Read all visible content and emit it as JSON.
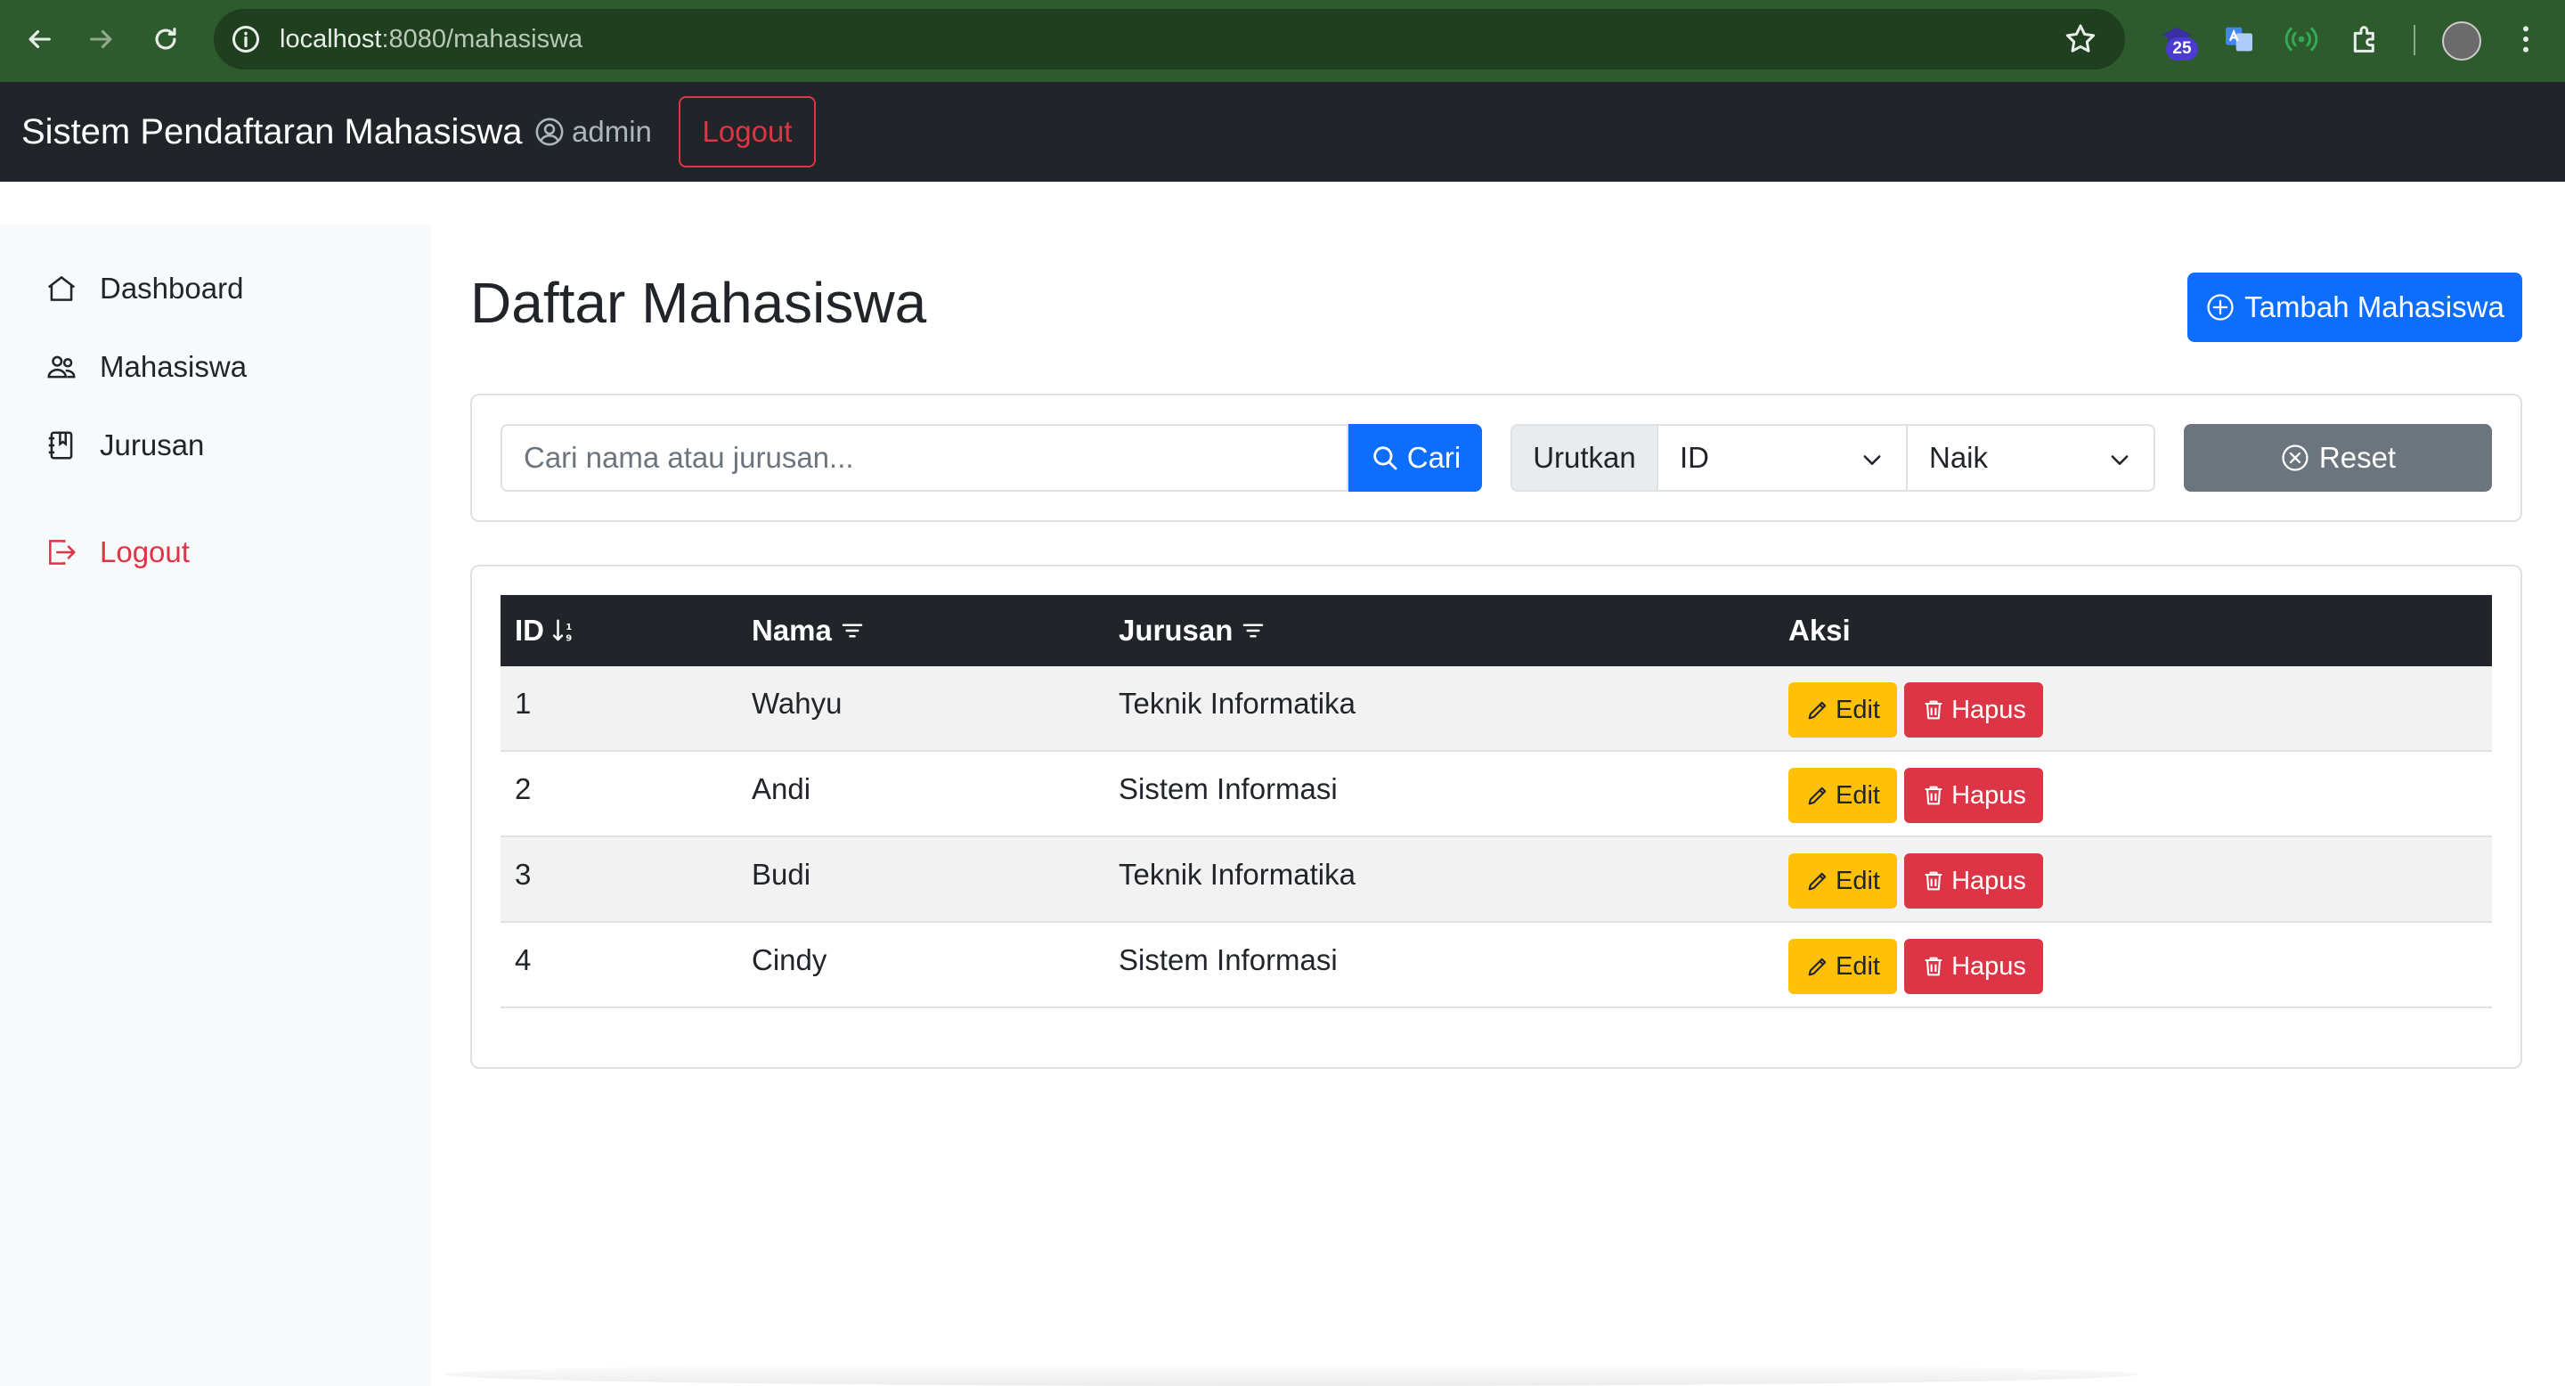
{
  "browser": {
    "url_host": "localhost",
    "url_rest": ":8080/mahasiswa",
    "extension_badge": "25"
  },
  "navbar": {
    "brand": "Sistem Pendaftaran Mahasiswa",
    "user": "admin",
    "logout_label": "Logout"
  },
  "sidebar": {
    "items": [
      {
        "label": "Dashboard",
        "icon": "house-icon"
      },
      {
        "label": "Mahasiswa",
        "icon": "people-icon"
      },
      {
        "label": "Jurusan",
        "icon": "journal-icon"
      }
    ],
    "logout_label": "Logout"
  },
  "page": {
    "title": "Daftar Mahasiswa",
    "add_button": "Tambah Mahasiswa"
  },
  "search": {
    "placeholder": "Cari nama atau jurusan...",
    "button": "Cari",
    "sort_label": "Urutkan",
    "sort_field": "ID",
    "sort_order": "Naik",
    "reset_button": "Reset"
  },
  "table": {
    "headers": [
      "ID",
      "Nama",
      "Jurusan",
      "Aksi"
    ],
    "rows": [
      {
        "id": "1",
        "nama": "Wahyu",
        "jurusan": "Teknik Informatika"
      },
      {
        "id": "2",
        "nama": "Andi",
        "jurusan": "Sistem Informasi"
      },
      {
        "id": "3",
        "nama": "Budi",
        "jurusan": "Teknik Informatika"
      },
      {
        "id": "4",
        "nama": "Cindy",
        "jurusan": "Sistem Informasi"
      }
    ],
    "edit_label": "Edit",
    "delete_label": "Hapus"
  },
  "colors": {
    "primary": "#0d6efd",
    "danger": "#dc3545",
    "warning": "#ffc107",
    "secondary": "#6c757d",
    "dark": "#212529",
    "browser_frame": "#2e5b2e"
  }
}
